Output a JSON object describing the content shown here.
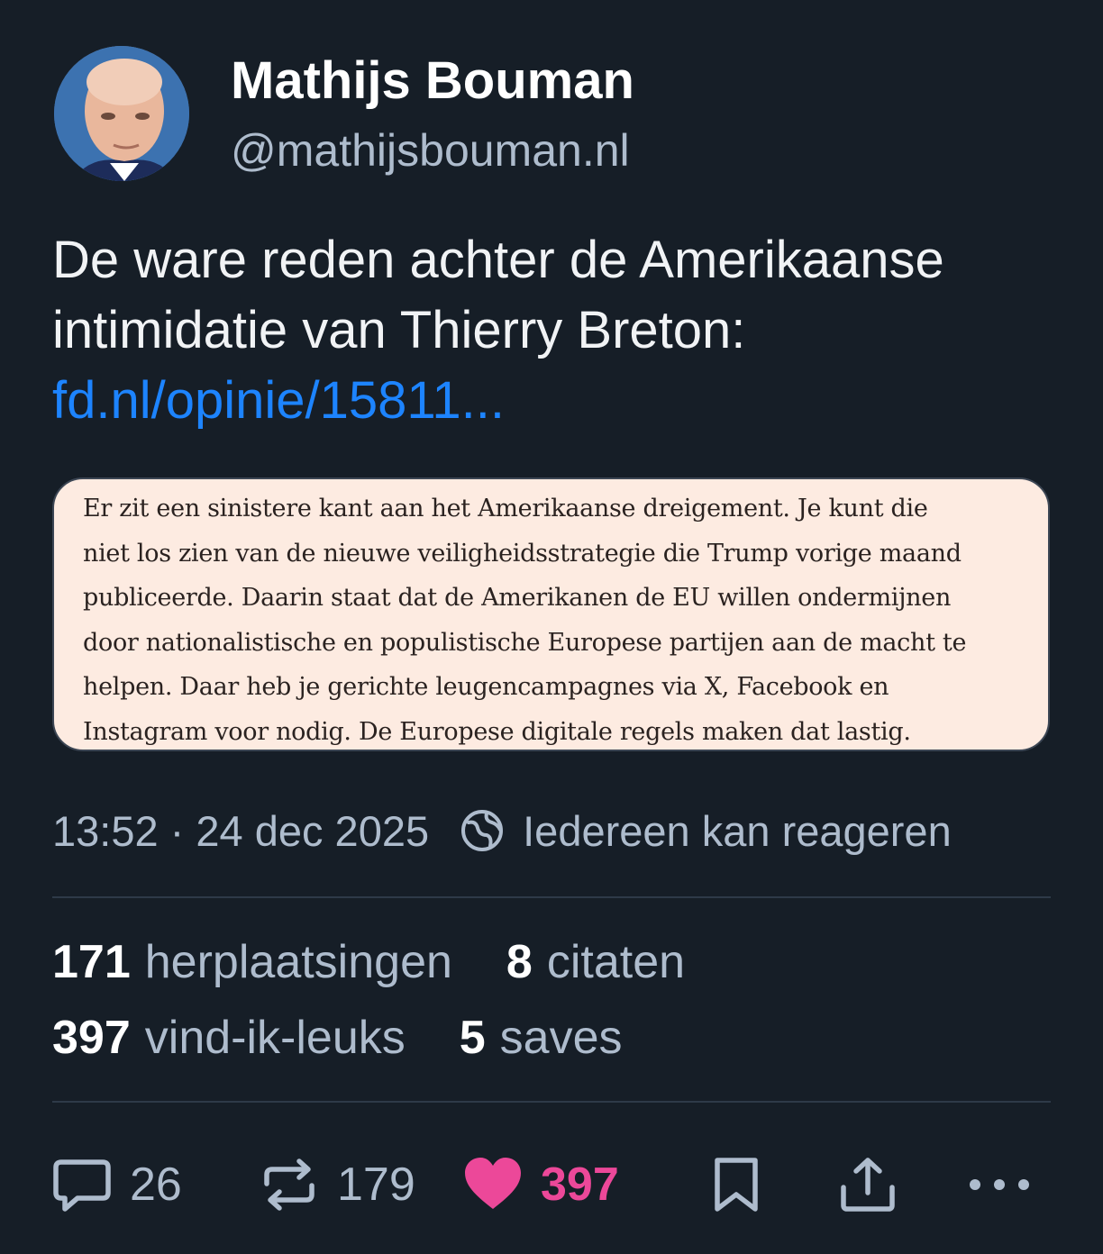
{
  "author": {
    "name": "Mathijs Bouman",
    "handle": "@mathijsbouman.nl"
  },
  "post": {
    "text_lines": [
      "De ware reden achter de Amerikaanse",
      "intimidatie van Thierry Breton:"
    ],
    "link_text": "fd.nl/opinie/15811..."
  },
  "quote_image": {
    "lines": [
      "Er zit een sinistere kant aan het Amerikaanse dreigement. Je kunt die",
      "niet los zien van de nieuwe veiligheidsstrategie die Trump vorige maand",
      "publiceerde. Daarin staat dat de Amerikanen de EU willen ondermijnen",
      "door nationalistische en populistische Europese partijen aan de macht te",
      "helpen. Daar heb je gerichte leugencampagnes via X, Facebook en",
      "Instagram voor nodig. De Europese digitale regels maken dat lastig."
    ]
  },
  "meta": {
    "timestamp": "13:52 · 24 dec 2025",
    "reply_setting": "Iedereen kan reageren",
    "reply_setting_icon": "globe-icon"
  },
  "stats": {
    "reposts": {
      "count": "171",
      "label": "herplaatsingen"
    },
    "quotes": {
      "count": "8",
      "label": "citaten"
    },
    "likes": {
      "count": "397",
      "label": "vind-ik-leuks"
    },
    "saves": {
      "count": "5",
      "label": "saves"
    }
  },
  "actions": {
    "reply_count": "26",
    "repost_count": "179",
    "like_count": "397",
    "icons": [
      "reply-icon",
      "repost-icon",
      "like-icon",
      "bookmark-icon",
      "share-icon",
      "more-icon"
    ]
  },
  "colors": {
    "background": "#161e27",
    "link": "#1d84ff",
    "muted": "#aebccd",
    "like": "#ec4899",
    "quote_bg": "#fdebe1"
  }
}
